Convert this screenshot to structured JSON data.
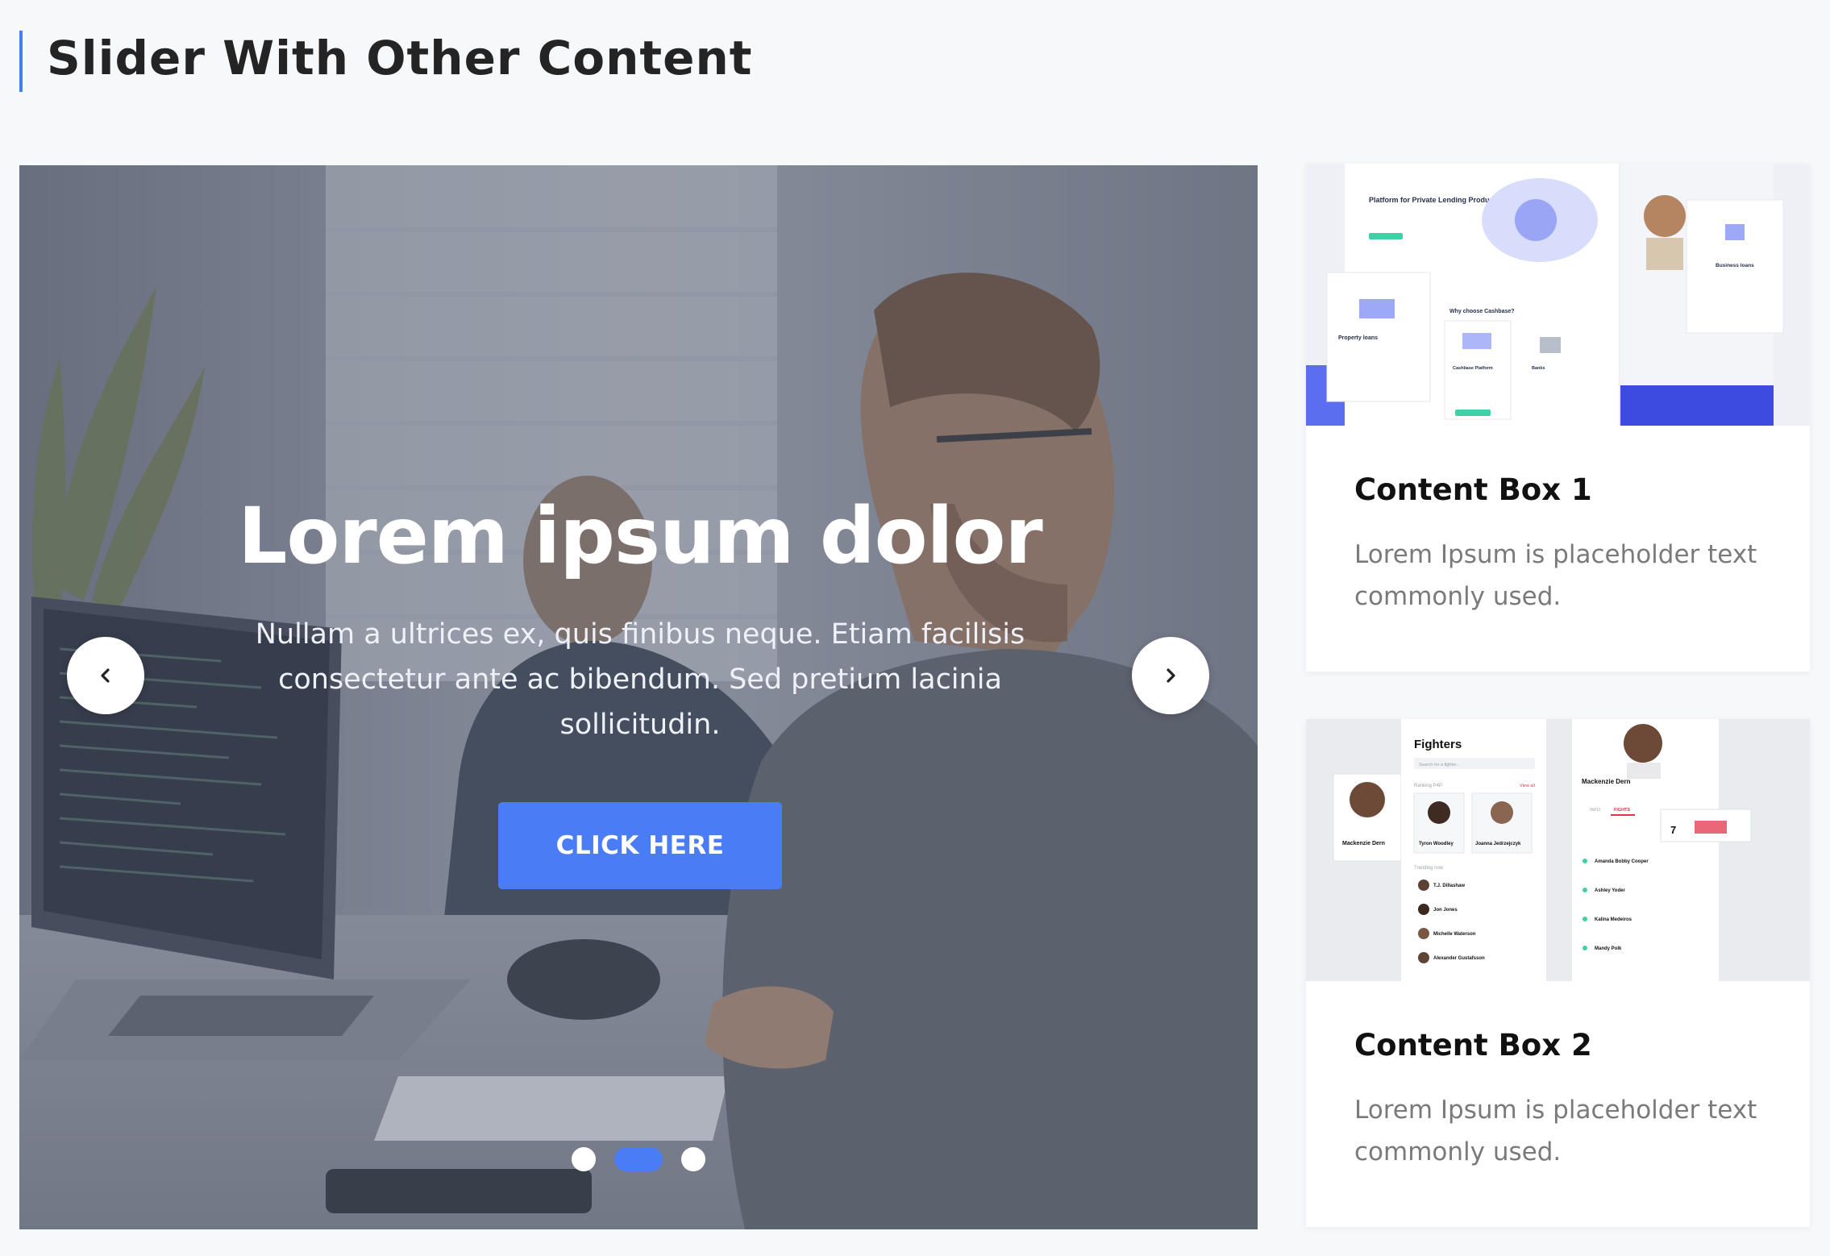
{
  "section": {
    "title": "Slider With Other Content"
  },
  "slider": {
    "slides": [
      {
        "title": "Lorem ipsum dolor",
        "text": "Nullam a ultrices ex, quis finibus neque. Etiam facilisis consectetur ante ac bibendum. Sed pretium lacinia sollicitudin.",
        "button_label": "CLICK HERE"
      }
    ],
    "active_slide": 2,
    "slide_count": 3,
    "prev_icon": "chevron-left-icon",
    "next_icon": "chevron-right-icon"
  },
  "content_boxes": [
    {
      "title": "Content Box 1",
      "text": "Lorem Ipsum is placeholder text commonly used."
    },
    {
      "title": "Content Box 2",
      "text": "Lorem Ipsum is placeholder text commonly used."
    }
  ],
  "thumb1": {
    "hero": "Platform for Private Lending Products",
    "card_left": "Property loans",
    "section": "Why choose Cashbase?",
    "col_a": "Cashbase Platform",
    "col_b": "Banks",
    "card_right": "Business loans"
  },
  "thumb2": {
    "panel_title": "Fighters",
    "search_placeholder": "Search for a fighter...",
    "ranking": "Ranking P4P",
    "view_all": "View all",
    "trending": "Trending now",
    "profile_name": "Mackenzie Dern",
    "fighters_top": [
      "Tyron Woodley",
      "Joanna Jedrzejczyk"
    ],
    "fighters_list": [
      "T.J. Dillashaw",
      "Jon Jones",
      "Michelle Waterson",
      "Alexander Gustafsson"
    ],
    "fight_history": [
      "Amanda Bobby Cooper",
      "Ashley Yoder",
      "Kalina Medeiros",
      "Mandy Polk"
    ],
    "tabs": [
      "INFO",
      "FIGHTS"
    ],
    "stat": "7"
  },
  "colors": {
    "accent": "#4a7cf5",
    "background": "#f7f8fa",
    "text_muted": "#7a7a7a"
  }
}
